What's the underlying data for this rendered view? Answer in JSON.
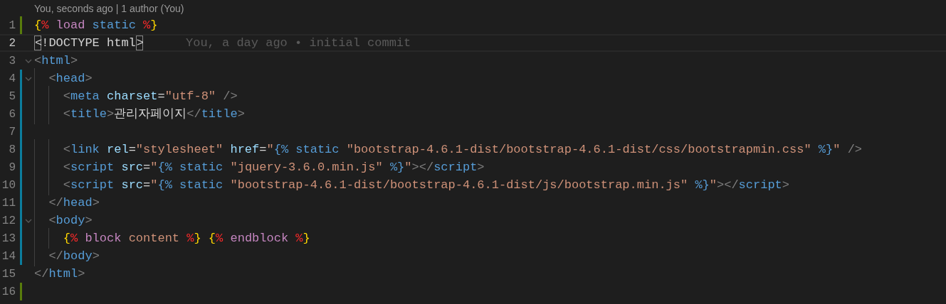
{
  "blame_header": "You, seconds ago | 1 author (You)",
  "lines": [
    {
      "number": "1",
      "modified": true,
      "added": false,
      "current": false,
      "foldable": false,
      "tokens": [
        {
          "kind": "brace",
          "text": "{"
        },
        {
          "kind": "percent",
          "text": "%"
        },
        {
          "kind": "keyword",
          "text": " load"
        },
        {
          "kind": "name",
          "text": " static"
        },
        {
          "kind": "percent",
          "text": " %"
        },
        {
          "kind": "brace",
          "text": "}"
        }
      ]
    },
    {
      "number": "2",
      "modified": false,
      "added": false,
      "current": true,
      "foldable": false,
      "blame": "You, a day ago • initial commit",
      "tokens": [
        {
          "kind": "match",
          "text": "<"
        },
        {
          "kind": "text",
          "text": "!DOCTYPE html"
        },
        {
          "kind": "match",
          "text": ">"
        }
      ]
    },
    {
      "number": "3",
      "modified": false,
      "added": false,
      "current": false,
      "foldable": true,
      "tokens": [
        {
          "kind": "punct",
          "text": "<"
        },
        {
          "kind": "tag",
          "text": "html"
        },
        {
          "kind": "punct",
          "text": ">"
        }
      ]
    },
    {
      "number": "4",
      "modified": false,
      "added": true,
      "current": false,
      "foldable": true,
      "tokens": [
        {
          "kind": "punct",
          "text": "  <"
        },
        {
          "kind": "tag",
          "text": "head"
        },
        {
          "kind": "punct",
          "text": ">"
        }
      ]
    },
    {
      "number": "5",
      "modified": false,
      "added": true,
      "current": false,
      "foldable": false,
      "tokens": [
        {
          "kind": "punct",
          "text": "    <"
        },
        {
          "kind": "tag",
          "text": "meta"
        },
        {
          "kind": "attr",
          "text": " charset"
        },
        {
          "kind": "text",
          "text": "="
        },
        {
          "kind": "string",
          "text": "\"utf-8\""
        },
        {
          "kind": "punct",
          "text": " />"
        }
      ]
    },
    {
      "number": "6",
      "modified": false,
      "added": true,
      "current": false,
      "foldable": false,
      "tokens": [
        {
          "kind": "punct",
          "text": "    <"
        },
        {
          "kind": "tag",
          "text": "title"
        },
        {
          "kind": "punct",
          "text": ">"
        },
        {
          "kind": "text",
          "text": "관리자페이지"
        },
        {
          "kind": "punct",
          "text": "</"
        },
        {
          "kind": "tag",
          "text": "title"
        },
        {
          "kind": "punct",
          "text": ">"
        }
      ]
    },
    {
      "number": "7",
      "modified": false,
      "added": true,
      "current": false,
      "foldable": false
    },
    {
      "number": "8",
      "modified": false,
      "added": true,
      "current": false,
      "foldable": false,
      "tokens": [
        {
          "kind": "punct",
          "text": "    <"
        },
        {
          "kind": "tag",
          "text": "link"
        },
        {
          "kind": "attr",
          "text": " rel"
        },
        {
          "kind": "text",
          "text": "="
        },
        {
          "kind": "string",
          "text": "\"stylesheet\""
        },
        {
          "kind": "attr",
          "text": " href"
        },
        {
          "kind": "text",
          "text": "="
        },
        {
          "kind": "string",
          "text": "\""
        },
        {
          "kind": "name",
          "text": "{% static"
        },
        {
          "kind": "string",
          "text": " \"bootstrap-4.6.1-dist/bootstrap-4.6.1-dist/css/bootstrapmin.css\""
        },
        {
          "kind": "name",
          "text": " %}"
        },
        {
          "kind": "string",
          "text": "\""
        },
        {
          "kind": "punct",
          "text": " />"
        }
      ]
    },
    {
      "number": "9",
      "modified": false,
      "added": true,
      "current": false,
      "foldable": false,
      "tokens": [
        {
          "kind": "punct",
          "text": "    <"
        },
        {
          "kind": "tag",
          "text": "script"
        },
        {
          "kind": "attr",
          "text": " src"
        },
        {
          "kind": "text",
          "text": "="
        },
        {
          "kind": "string",
          "text": "\""
        },
        {
          "kind": "name",
          "text": "{% static"
        },
        {
          "kind": "string",
          "text": " \"jquery-3.6.0.min.js\""
        },
        {
          "kind": "name",
          "text": " %}"
        },
        {
          "kind": "string",
          "text": "\""
        },
        {
          "kind": "punct",
          "text": "></"
        },
        {
          "kind": "tag",
          "text": "script"
        },
        {
          "kind": "punct",
          "text": ">"
        }
      ]
    },
    {
      "number": "10",
      "modified": false,
      "added": true,
      "current": false,
      "foldable": false,
      "tokens": [
        {
          "kind": "punct",
          "text": "    <"
        },
        {
          "kind": "tag",
          "text": "script"
        },
        {
          "kind": "attr",
          "text": " src"
        },
        {
          "kind": "text",
          "text": "="
        },
        {
          "kind": "string",
          "text": "\""
        },
        {
          "kind": "name",
          "text": "{% static"
        },
        {
          "kind": "string",
          "text": " \"bootstrap-4.6.1-dist/bootstrap-4.6.1-dist/js/bootstrap.min.js\""
        },
        {
          "kind": "name",
          "text": " %}"
        },
        {
          "kind": "string",
          "text": "\""
        },
        {
          "kind": "punct",
          "text": "></"
        },
        {
          "kind": "tag",
          "text": "script"
        },
        {
          "kind": "punct",
          "text": ">"
        }
      ]
    },
    {
      "number": "11",
      "modified": false,
      "added": true,
      "current": false,
      "foldable": false,
      "tokens": [
        {
          "kind": "punct",
          "text": "  </"
        },
        {
          "kind": "tag",
          "text": "head"
        },
        {
          "kind": "punct",
          "text": ">"
        }
      ]
    },
    {
      "number": "12",
      "modified": false,
      "added": true,
      "current": false,
      "foldable": true,
      "tokens": [
        {
          "kind": "punct",
          "text": "  <"
        },
        {
          "kind": "tag",
          "text": "body"
        },
        {
          "kind": "punct",
          "text": ">"
        }
      ]
    },
    {
      "number": "13",
      "modified": false,
      "added": true,
      "current": false,
      "foldable": false,
      "tokens": [
        {
          "kind": "brace",
          "text": "    {"
        },
        {
          "kind": "percent",
          "text": "%"
        },
        {
          "kind": "keyword",
          "text": " block"
        },
        {
          "kind": "value",
          "text": " content"
        },
        {
          "kind": "percent",
          "text": " %"
        },
        {
          "kind": "brace",
          "text": "}"
        },
        {
          "kind": "brace",
          "text": " {"
        },
        {
          "kind": "percent",
          "text": "%"
        },
        {
          "kind": "keyword",
          "text": " endblock"
        },
        {
          "kind": "percent",
          "text": " %"
        },
        {
          "kind": "brace",
          "text": "}"
        }
      ]
    },
    {
      "number": "14",
      "modified": false,
      "added": true,
      "current": false,
      "foldable": false,
      "tokens": [
        {
          "kind": "punct",
          "text": "  </"
        },
        {
          "kind": "tag",
          "text": "body"
        },
        {
          "kind": "punct",
          "text": ">"
        }
      ]
    },
    {
      "number": "15",
      "modified": false,
      "added": false,
      "current": false,
      "foldable": false,
      "tokens": [
        {
          "kind": "punct",
          "text": "</"
        },
        {
          "kind": "tag",
          "text": "html"
        },
        {
          "kind": "punct",
          "text": ">"
        }
      ]
    },
    {
      "number": "16",
      "modified": true,
      "added": false,
      "current": false,
      "foldable": false
    }
  ]
}
